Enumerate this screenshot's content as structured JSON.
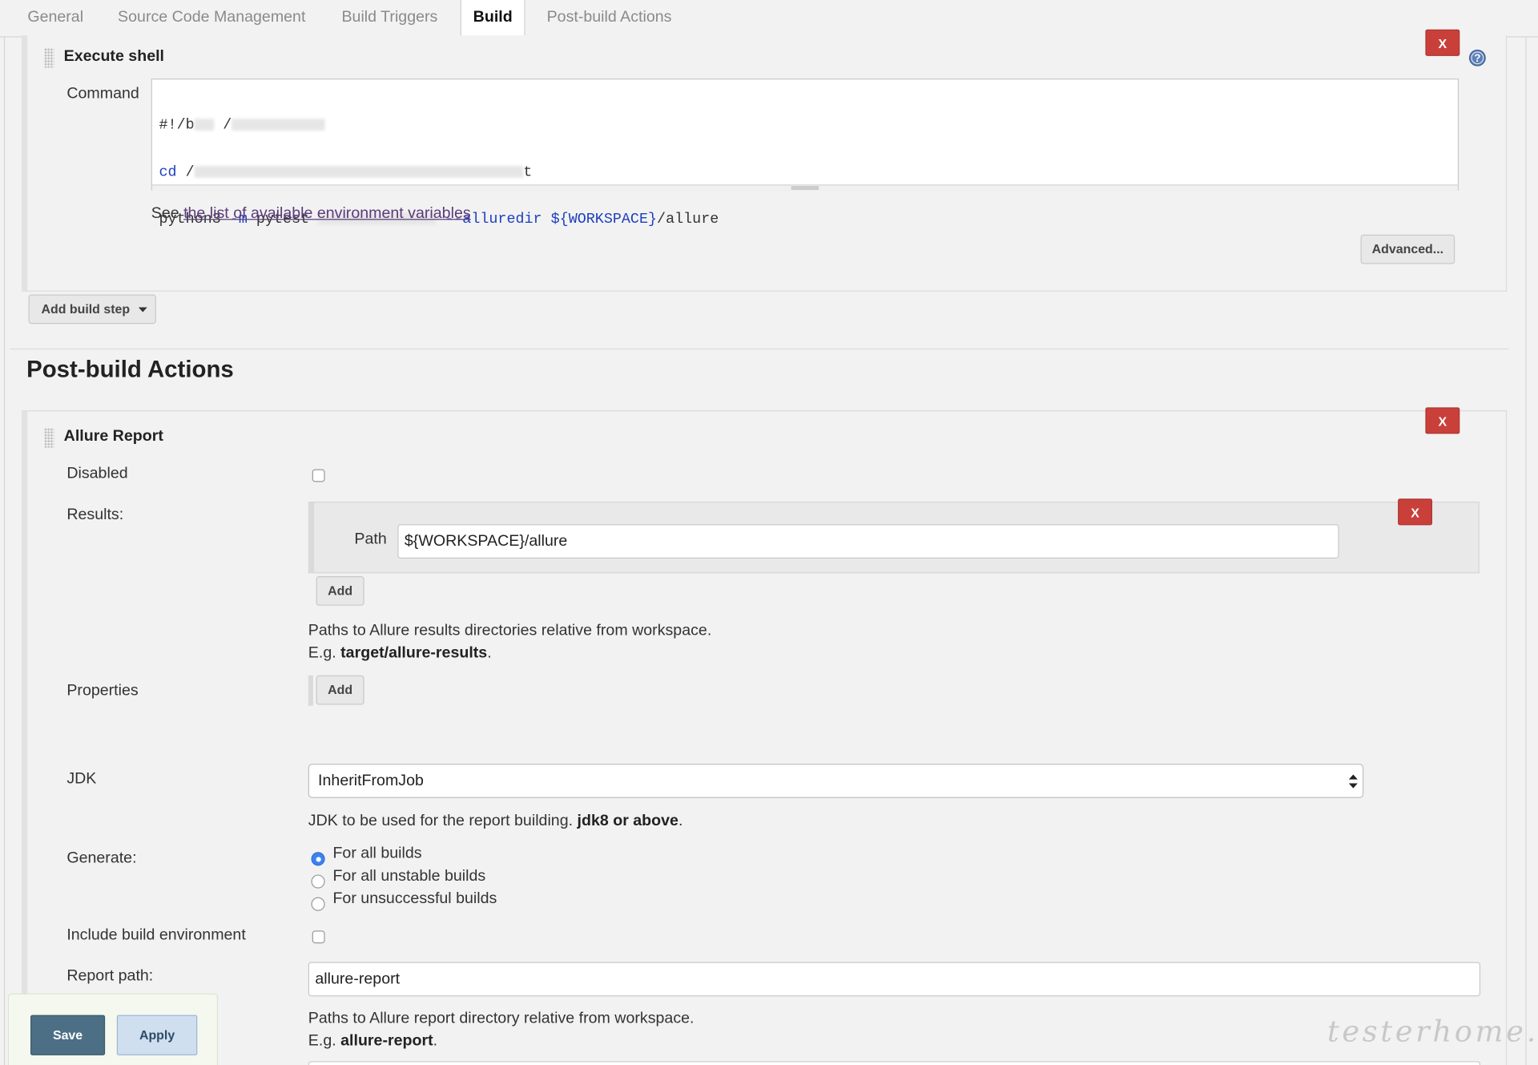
{
  "tabs": [
    {
      "label": "General"
    },
    {
      "label": "Source Code Management"
    },
    {
      "label": "Build Triggers"
    },
    {
      "label": "Build"
    },
    {
      "label": "Post-build Actions"
    }
  ],
  "active_tab": "Build",
  "execute_shell": {
    "title": "Execute shell",
    "command_label": "Command",
    "code_lines": {
      "line1": "#!/b",
      "line2_kw": "cd",
      "line2_rest": " /",
      "line3_a": "python3 ",
      "line3_flag": "-m",
      "line3_b": " pytest",
      "line3_allure": "--alluredir",
      "line3_var": "${WORKSPACE}",
      "line3_end": "/allure"
    },
    "see_text": "See",
    "env_link": "the list of available environment variables",
    "advanced_button": "Advanced...",
    "delete_label": "X"
  },
  "add_build_step": "Add build step",
  "post_build": {
    "heading": "Post-build Actions",
    "allure": {
      "title": "Allure Report",
      "delete_label": "X",
      "disabled_label": "Disabled",
      "results_label": "Results:",
      "path_label": "Path",
      "path_value": "${WORKSPACE}/allure",
      "path_delete": "X",
      "add_button": "Add",
      "results_help_1": "Paths to Allure results directories relative from workspace.",
      "results_help_2_prefix": "E.g.",
      "results_help_2_bold": "target/allure-results",
      "results_help_2_suffix": ".",
      "properties_label": "Properties",
      "properties_add": "Add",
      "jdk_label": "JDK",
      "jdk_value": "InheritFromJob",
      "jdk_help_prefix": "JDK to be used for the report building.",
      "jdk_help_bold": "jdk8 or above",
      "jdk_help_suffix": ".",
      "generate_label": "Generate:",
      "generate_options": [
        "For all builds",
        "For all unstable builds",
        "For unsuccessful builds"
      ],
      "generate_selected": "For all builds",
      "include_env_label": "Include build environment",
      "report_path_label": "Report path:",
      "report_path_value": "allure-report",
      "report_help_1": "Paths to Allure report directory relative from workspace.",
      "report_help_2_prefix": "E.g.",
      "report_help_2_bold": "allure-report",
      "report_help_2_suffix": "."
    }
  },
  "footer": {
    "save": "Save",
    "apply": "Apply"
  },
  "watermark": "testerhome.com",
  "icons": {
    "help": "help-icon",
    "dropdown": "caret-down-icon",
    "select": "select-arrows-icon",
    "drag": "drag-handle-icon"
  },
  "colors": {
    "delete_red": "#c9403a",
    "save_blue": "#4c6f86",
    "apply_light": "#cfdff0",
    "link_purple": "#5a3a7a",
    "keyword_blue": "#1d3fbf"
  }
}
